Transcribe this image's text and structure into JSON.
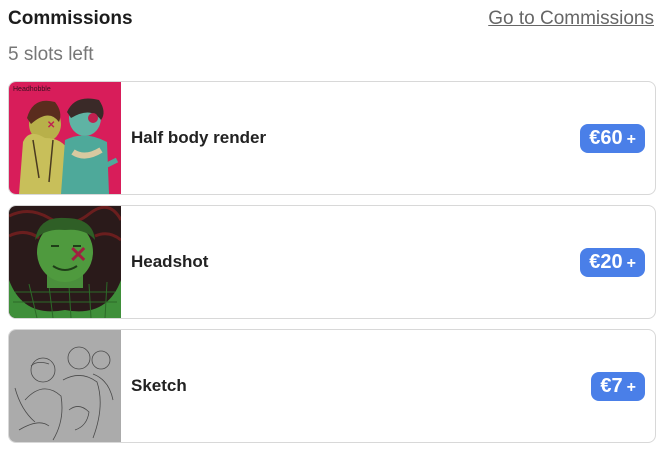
{
  "header": {
    "title": "Commissions",
    "link": "Go to Commissions"
  },
  "slots_text": "5 slots left",
  "items": [
    {
      "label": "Half body render",
      "price": "€60",
      "plus": "+",
      "thumb_text": "Headhobble"
    },
    {
      "label": "Headshot",
      "price": "€20",
      "plus": "+"
    },
    {
      "label": "Sketch",
      "price": "€7",
      "plus": "+"
    }
  ],
  "colors": {
    "accent": "#4a7fe8",
    "card1_bg": "#d81d5a",
    "card2_bg": "#2a1a1a",
    "card2_collar": "#3f8f3a",
    "card3_bg": "#ababab"
  }
}
